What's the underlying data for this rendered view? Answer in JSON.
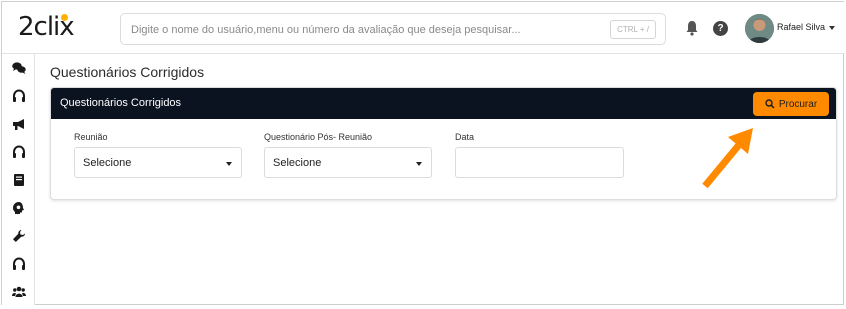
{
  "app": {
    "logo_text": "2clix"
  },
  "topbar": {
    "search_placeholder": "Digite o nome do usuário,menu ou número da avaliação que deseja pesquisar...",
    "shortcut": "CTRL + /",
    "help_glyph": "?",
    "user_name": "Rafael Silva"
  },
  "sidebar": {
    "icons": [
      "comments-icon",
      "headset-icon",
      "megaphone-icon",
      "headset-icon",
      "book-icon",
      "brain-gear-icon",
      "wrench-icon",
      "headset-icon",
      "users-icon"
    ]
  },
  "page": {
    "title": "Questionários Corrigidos"
  },
  "card": {
    "title": "Questionários Corrigidos",
    "search_button": "Procurar",
    "fields": {
      "reuniao_label": "Reunião",
      "reuniao_value": "Selecione",
      "questionario_label": "Questionário Pós- Reunião",
      "questionario_value": "Selecione",
      "data_label": "Data",
      "data_value": ""
    }
  },
  "colors": {
    "accent": "#ff8a00",
    "header_bg": "#0b1220",
    "logo_dot": "#ffb000"
  }
}
